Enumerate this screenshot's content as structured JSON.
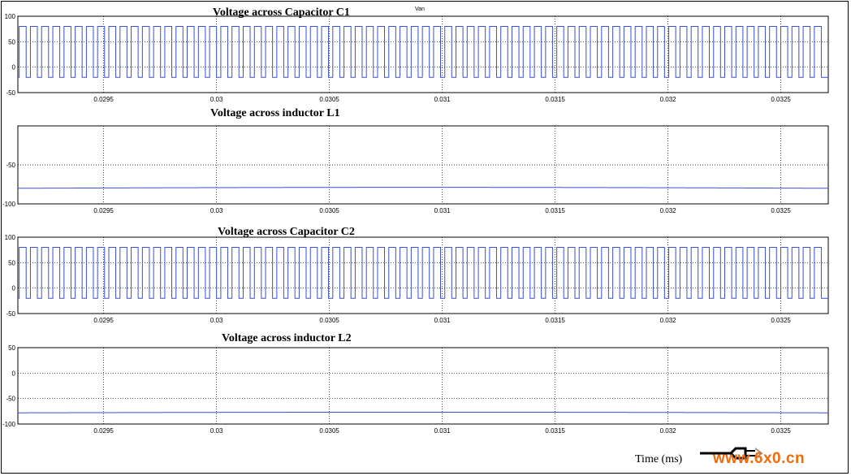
{
  "marker_label": "Van",
  "time_label": "Time (ms)",
  "watermark": {
    "text": "www.6x0.cn",
    "text_color": "#f26b0b"
  },
  "colors": {
    "trace": "#3a4ee0",
    "axes": "#000000",
    "grid": "#000000"
  },
  "chart_data": [
    {
      "type": "line",
      "title": "Voltage  across Capacitor C1",
      "waveform": "square pulse train",
      "pulse_count": 72,
      "high_level": 80,
      "low_level": -20,
      "x_ticks": [
        "0.0295",
        "0.03",
        "0.0305",
        "0.031",
        "0.0315",
        "0.032",
        "0.0325"
      ],
      "y_ticks": [
        "100",
        "50",
        "0",
        "-50"
      ],
      "xlim": [
        0.02912,
        0.03271
      ],
      "ylim": [
        -50,
        100
      ],
      "grid": true
    },
    {
      "type": "line",
      "title": "Voltage across inductor L1",
      "waveform": "nearly constant",
      "level": -80,
      "x_ticks": [
        "0.0295",
        "0.03",
        "0.0305",
        "0.031",
        "0.0315",
        "0.032",
        "0.0325"
      ],
      "y_ticks": [
        "-50",
        "-100"
      ],
      "xlim": [
        0.02912,
        0.03271
      ],
      "ylim": [
        -100,
        0
      ],
      "grid": true
    },
    {
      "type": "line",
      "title": "Voltage across Capacitor C2",
      "waveform": "square pulse train",
      "pulse_count": 72,
      "high_level": 80,
      "low_level": -20,
      "x_ticks": [
        "0.0295",
        "0.03",
        "0.0305",
        "0.031",
        "0.0315",
        "0.032",
        "0.0325"
      ],
      "y_ticks": [
        "100",
        "50",
        "0",
        "-50"
      ],
      "xlim": [
        0.02912,
        0.03271
      ],
      "ylim": [
        -50,
        100
      ],
      "grid": true
    },
    {
      "type": "line",
      "title": "Voltage across inductor L2",
      "waveform": "nearly constant",
      "level": -78,
      "x_ticks": [
        "0.0295",
        "0.03",
        "0.0305",
        "0.031",
        "0.0315",
        "0.032",
        "0.0325"
      ],
      "y_ticks": [
        "50",
        "0",
        "-50",
        "-100"
      ],
      "xlim": [
        0.02912,
        0.03271
      ],
      "ylim": [
        -100,
        50
      ],
      "grid": true
    }
  ]
}
